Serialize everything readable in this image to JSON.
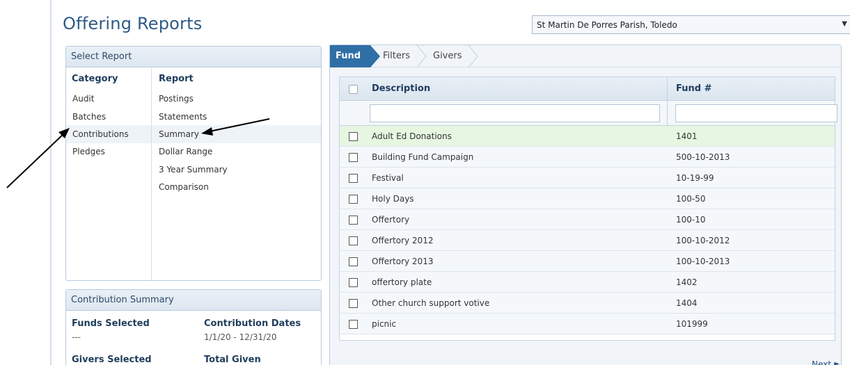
{
  "page": {
    "title": "Offering Reports"
  },
  "parish_select": {
    "value": "St Martin De Porres Parish, Toledo"
  },
  "select_report": {
    "header": "Select Report",
    "category_heading": "Category",
    "report_heading": "Report",
    "categories": [
      "Audit",
      "Batches",
      "Contributions",
      "Pledges"
    ],
    "selected_category": "Contributions",
    "reports": [
      "Postings",
      "Statements",
      "Summary",
      "Dollar Range",
      "3 Year Summary",
      "Comparison"
    ],
    "selected_report": "Summary"
  },
  "contribution_summary": {
    "header": "Contribution Summary",
    "funds_selected_label": "Funds Selected",
    "funds_selected_value": "---",
    "contribution_dates_label": "Contribution Dates",
    "contribution_dates_value": "1/1/20 - 12/31/20",
    "givers_selected_label": "Givers Selected",
    "total_given_label": "Total Given"
  },
  "wizard": {
    "steps": [
      "Fund",
      "Filters",
      "Givers"
    ],
    "active_step": "Fund",
    "columns": {
      "description": "Description",
      "fund_number": "Fund #"
    },
    "filters": {
      "description": "",
      "fund_number": ""
    },
    "rows": [
      {
        "description": "Adult Ed Donations",
        "fund": "1401",
        "highlighted": true
      },
      {
        "description": "Building Fund Campaign",
        "fund": "500-10-2013"
      },
      {
        "description": "Festival",
        "fund": "10-19-99"
      },
      {
        "description": "Holy Days",
        "fund": "100-50"
      },
      {
        "description": "Offertory",
        "fund": "100-10"
      },
      {
        "description": "Offertory 2012",
        "fund": "100-10-2012"
      },
      {
        "description": "Offertory 2013",
        "fund": "100-10-2013"
      },
      {
        "description": "offertory plate",
        "fund": "1402"
      },
      {
        "description": "Other church support votive",
        "fund": "1404"
      },
      {
        "description": "picnic",
        "fund": "101999"
      }
    ],
    "next_label": "Next"
  },
  "colors": {
    "title": "#2e5a87",
    "active_step": "#2f6fa6",
    "row_highlight": "#e6f6e1"
  }
}
